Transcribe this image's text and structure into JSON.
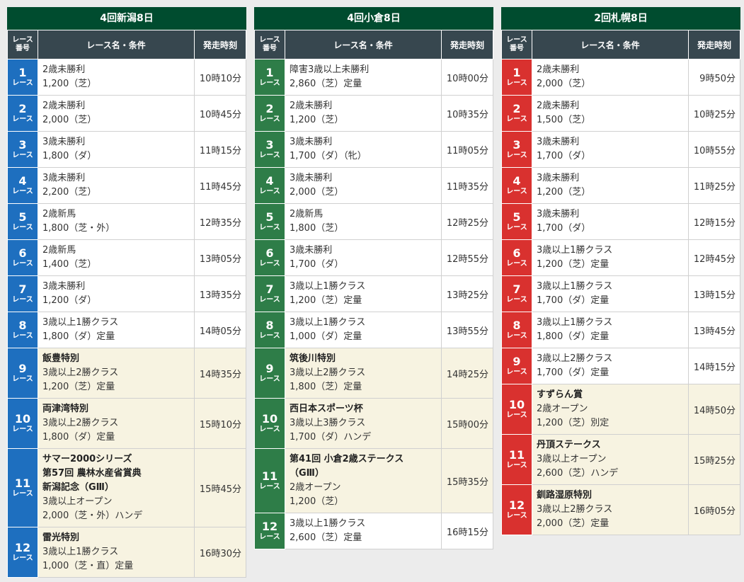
{
  "venues": [
    {
      "title": "4回新潟8日",
      "headers": {
        "num_line1": "レース",
        "num_line2": "番号",
        "name": "レース名・条件",
        "time": "発走時刻"
      },
      "races": [
        {
          "num": "1",
          "unit": "レース",
          "lines": [
            "2歳未勝利",
            "1,200（芝）"
          ],
          "time": "10時10分"
        },
        {
          "num": "2",
          "unit": "レース",
          "lines": [
            "2歳未勝利",
            "2,000（芝）"
          ],
          "time": "10時45分"
        },
        {
          "num": "3",
          "unit": "レース",
          "lines": [
            "3歳未勝利",
            "1,800（ダ）"
          ],
          "time": "11時15分"
        },
        {
          "num": "4",
          "unit": "レース",
          "lines": [
            "3歳未勝利",
            "2,200（芝）"
          ],
          "time": "11時45分"
        },
        {
          "num": "5",
          "unit": "レース",
          "lines": [
            "2歳新馬",
            "1,800（芝・外）"
          ],
          "time": "12時35分"
        },
        {
          "num": "6",
          "unit": "レース",
          "lines": [
            "2歳新馬",
            "1,400（芝）"
          ],
          "time": "13時05分"
        },
        {
          "num": "7",
          "unit": "レース",
          "lines": [
            "3歳未勝利",
            "1,200（ダ）"
          ],
          "time": "13時35分"
        },
        {
          "num": "8",
          "unit": "レース",
          "lines": [
            "3歳以上1勝クラス",
            "1,800（ダ）定量"
          ],
          "time": "14時05分"
        },
        {
          "num": "9",
          "unit": "レース",
          "title": "飯豊特別",
          "lines": [
            "3歳以上2勝クラス",
            "1,200（芝）定量"
          ],
          "time": "14時35分"
        },
        {
          "num": "10",
          "unit": "レース",
          "title": "両津湾特別",
          "lines": [
            "3歳以上2勝クラス",
            "1,800（ダ）定量"
          ],
          "time": "15時10分"
        },
        {
          "num": "11",
          "unit": "レース",
          "title": "サマー2000シリーズ\n第57回 農林水産省賞典\n新潟記念（GⅢ）",
          "lines": [
            "3歳以上オープン",
            "2,000（芝・外）ハンデ"
          ],
          "time": "15時45分"
        },
        {
          "num": "12",
          "unit": "レース",
          "title": "雷光特別",
          "lines": [
            "3歳以上1勝クラス",
            "1,000（芝・直）定量"
          ],
          "time": "16時30分"
        }
      ]
    },
    {
      "title": "4回小倉8日",
      "headers": {
        "num_line1": "レース",
        "num_line2": "番号",
        "name": "レース名・条件",
        "time": "発走時刻"
      },
      "races": [
        {
          "num": "1",
          "unit": "レース",
          "lines": [
            "障害3歳以上未勝利",
            "2,860（芝）定量"
          ],
          "time": "10時00分"
        },
        {
          "num": "2",
          "unit": "レース",
          "lines": [
            "2歳未勝利",
            "1,200（芝）"
          ],
          "time": "10時35分"
        },
        {
          "num": "3",
          "unit": "レース",
          "lines": [
            "3歳未勝利",
            "1,700（ダ）（牝）"
          ],
          "time": "11時05分"
        },
        {
          "num": "4",
          "unit": "レース",
          "lines": [
            "3歳未勝利",
            "2,000（芝）"
          ],
          "time": "11時35分"
        },
        {
          "num": "5",
          "unit": "レース",
          "lines": [
            "2歳新馬",
            "1,800（芝）"
          ],
          "time": "12時25分"
        },
        {
          "num": "6",
          "unit": "レース",
          "lines": [
            "3歳未勝利",
            "1,700（ダ）"
          ],
          "time": "12時55分"
        },
        {
          "num": "7",
          "unit": "レース",
          "lines": [
            "3歳以上1勝クラス",
            "1,200（芝）定量"
          ],
          "time": "13時25分"
        },
        {
          "num": "8",
          "unit": "レース",
          "lines": [
            "3歳以上1勝クラス",
            "1,000（ダ）定量"
          ],
          "time": "13時55分"
        },
        {
          "num": "9",
          "unit": "レース",
          "title": "筑後川特別",
          "lines": [
            "3歳以上2勝クラス",
            "1,800（芝）定量"
          ],
          "time": "14時25分"
        },
        {
          "num": "10",
          "unit": "レース",
          "title": "西日本スポーツ杯",
          "lines": [
            "3歳以上3勝クラス",
            "1,700（ダ）ハンデ"
          ],
          "time": "15時00分"
        },
        {
          "num": "11",
          "unit": "レース",
          "title": "第41回 小倉2歳ステークス\n（GⅢ）",
          "lines": [
            "2歳オープン",
            "1,200（芝）"
          ],
          "time": "15時35分"
        },
        {
          "num": "12",
          "unit": "レース",
          "lines": [
            "3歳以上1勝クラス",
            "2,600（芝）定量"
          ],
          "time": "16時15分"
        }
      ]
    },
    {
      "title": "2回札幌8日",
      "headers": {
        "num_line1": "レース",
        "num_line2": "番号",
        "name": "レース名・条件",
        "time": "発走時刻"
      },
      "races": [
        {
          "num": "1",
          "unit": "レース",
          "lines": [
            "2歳未勝利",
            "2,000（芝）"
          ],
          "time": "9時50分"
        },
        {
          "num": "2",
          "unit": "レース",
          "lines": [
            "2歳未勝利",
            "1,500（芝）"
          ],
          "time": "10時25分"
        },
        {
          "num": "3",
          "unit": "レース",
          "lines": [
            "3歳未勝利",
            "1,700（ダ）"
          ],
          "time": "10時55分"
        },
        {
          "num": "4",
          "unit": "レース",
          "lines": [
            "3歳未勝利",
            "1,200（芝）"
          ],
          "time": "11時25分"
        },
        {
          "num": "5",
          "unit": "レース",
          "lines": [
            "3歳未勝利",
            "1,700（ダ）"
          ],
          "time": "12時15分"
        },
        {
          "num": "6",
          "unit": "レース",
          "lines": [
            "3歳以上1勝クラス",
            "1,200（芝）定量"
          ],
          "time": "12時45分"
        },
        {
          "num": "7",
          "unit": "レース",
          "lines": [
            "3歳以上1勝クラス",
            "1,700（ダ）定量"
          ],
          "time": "13時15分"
        },
        {
          "num": "8",
          "unit": "レース",
          "lines": [
            "3歳以上1勝クラス",
            "1,800（ダ）定量"
          ],
          "time": "13時45分"
        },
        {
          "num": "9",
          "unit": "レース",
          "lines": [
            "3歳以上2勝クラス",
            "1,700（ダ）定量"
          ],
          "time": "14時15分"
        },
        {
          "num": "10",
          "unit": "レース",
          "title": "すずらん賞",
          "lines": [
            "2歳オープン",
            "1,200（芝）別定"
          ],
          "time": "14時50分"
        },
        {
          "num": "11",
          "unit": "レース",
          "title": "丹頂ステークス",
          "lines": [
            "3歳以上オープン",
            "2,600（芝）ハンデ"
          ],
          "time": "15時25分"
        },
        {
          "num": "12",
          "unit": "レース",
          "title": "釧路湿原特別",
          "lines": [
            "3歳以上2勝クラス",
            "2,000（芝）定量"
          ],
          "time": "16時05分"
        }
      ]
    }
  ]
}
